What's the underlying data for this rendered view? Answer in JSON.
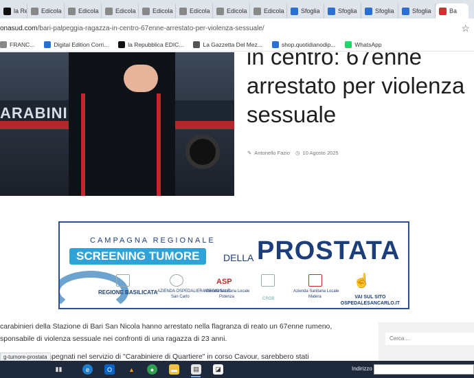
{
  "browser": {
    "tabs": [
      {
        "label": "la Rep",
        "icon": "repubblica-icon",
        "color": "#111111"
      },
      {
        "label": "Edicola",
        "icon": "page-icon",
        "color": "#888888"
      },
      {
        "label": "Edicola",
        "icon": "page-icon",
        "color": "#888888"
      },
      {
        "label": "Edicola",
        "icon": "page-icon",
        "color": "#888888"
      },
      {
        "label": "Edicola",
        "icon": "page-icon",
        "color": "#888888"
      },
      {
        "label": "Edicola",
        "icon": "page-icon",
        "color": "#888888"
      },
      {
        "label": "Edicola",
        "icon": "page-icon",
        "color": "#888888"
      },
      {
        "label": "Edicola",
        "icon": "page-icon",
        "color": "#888888"
      },
      {
        "label": "Sfoglia",
        "icon": "q-icon",
        "color": "#2a6fd6"
      },
      {
        "label": "Sfoglia",
        "icon": "q-icon",
        "color": "#2a6fd6"
      },
      {
        "label": "Sfoglia",
        "icon": "q-icon",
        "color": "#2a6fd6"
      },
      {
        "label": "Sfoglia",
        "icon": "q-icon",
        "color": "#2a6fd6"
      },
      {
        "label": "Ba",
        "icon": "site-icon",
        "color": "#d32f2f"
      }
    ],
    "url_domain": "onasud.com",
    "url_path": "/bari-palpeggia-ragazza-in-centro-67enne-arrestato-per-violenza-sessuale/",
    "bookmarks": [
      {
        "label": "FRANC...",
        "icon": "folder-icon"
      },
      {
        "label": "Digital Edition Corri...",
        "icon": "c-icon"
      },
      {
        "label": "la Repubblica EDIC...",
        "icon": "repubblica-icon"
      },
      {
        "label": "La Gazzetta Del Mez...",
        "icon": "globe-icon"
      },
      {
        "label": "shop.quotidianodip...",
        "icon": "q-icon"
      },
      {
        "label": "WhatsApp",
        "icon": "whatsapp-icon"
      }
    ]
  },
  "article": {
    "headline_lines": [
      "in centro: 67enne",
      "arrestato per violenza",
      "sessuale"
    ],
    "author": "Antonello Fazio",
    "date": "10 Agosto 2025",
    "photo_text": "ARABINIERI",
    "paragraph_lines": [
      "carabinieri della Stazione di Bari San Nicola hanno arrestato nella flagranza di reato un 67enne rumeno,",
      "sponsabile di violenza sessuale nei confronti di una ragazza di 23 anni.",
      "impegnati nel servizio di \"Carabiniere di Quartiere\" in corso Cavour, sarebbero stati"
    ]
  },
  "banner": {
    "campagna": "CAMPAGNA REGIONALE",
    "screening": "SCREENING TUMORE",
    "della": "DELLA",
    "prostata": "PROSTATA",
    "logo1": "REGIONE BASILICATA",
    "logo2_top": "AZIENDA OSPEDALIERA REGIONALE",
    "logo2_bottom": "San Carlo",
    "logo3_top": "ASP",
    "logo3_mid": "Azienda Sanitaria Locale",
    "logo3_bottom": "Potenza",
    "logo4": "CROB",
    "logo5_top": "Azienda Sanitaria Locale",
    "logo5_bottom": "Matera",
    "vai_line1": "VAI SUL SITO",
    "vai_line2": "OSPEDALESANCARLO.IT"
  },
  "sidebar": {
    "search_placeholder": "Cerca ..."
  },
  "status_link": "g-tumore-prostata",
  "taskbar": {
    "indirizzo": "Indirizzo"
  }
}
